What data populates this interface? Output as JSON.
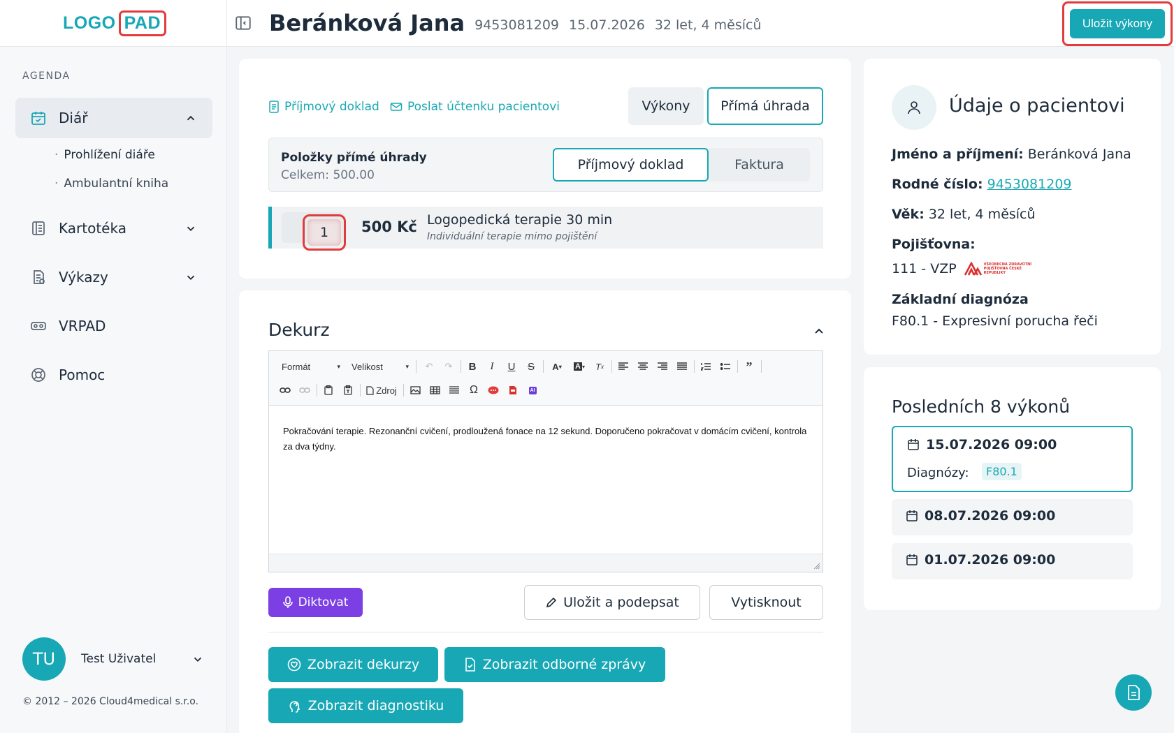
{
  "logo": {
    "part1": "LOGO",
    "part2": "PAD"
  },
  "sidebar": {
    "section_label": "AGENDA",
    "items": [
      {
        "label": "Diář",
        "icon": "calendar-icon"
      },
      {
        "label": "Kartotéka",
        "icon": "file-cabinet-icon"
      },
      {
        "label": "Výkazy",
        "icon": "report-icon"
      },
      {
        "label": "VRPAD",
        "icon": "vr-headset-icon"
      },
      {
        "label": "Pomoc",
        "icon": "lifebuoy-icon"
      }
    ],
    "sub_items": [
      "Prohlížení diáře",
      "Ambulantní kniha"
    ],
    "user": {
      "initials": "TU",
      "name": "Test Uživatel"
    },
    "copyright": "© 2012 – 2026 Cloud4medical s.r.o."
  },
  "header": {
    "patient_name": "Beránková Jana",
    "birth_number": "9453081209",
    "date": "15.07.2026",
    "age": "32 let, 4 měsíců",
    "save_label": "Uložit výkony"
  },
  "payment": {
    "link_receipt": "Příjmový doklad",
    "link_send": "Poslat účtenku pacientovi",
    "tab_vykony": "Výkony",
    "tab_prima": "Přímá úhrada",
    "items_title": "Položky přímé úhrady",
    "items_total": "Celkem: 500.00",
    "doc_receipt": "Příjmový doklad",
    "doc_invoice": "Faktura",
    "item": {
      "quantity": "1",
      "price": "500 Kč",
      "name": "Logopedická terapie 30 min",
      "subtitle": "Individuální terapie mimo pojištění"
    }
  },
  "dekurz": {
    "title": "Dekurz",
    "toolbar": {
      "format": "Formát",
      "size": "Velikost",
      "source": "Zdroj",
      "bold": "B",
      "italic": "I",
      "underline": "U",
      "strike": "S",
      "omega": "Ω",
      "ai": "AI"
    },
    "content": "Pokračování terapie. Rezonanční cvičení, prodloužená fonace na 12 sekund. Doporučeno pokračovat v domácím cvičení, kontrola za dva týdny.",
    "btn_dictate": "Diktovat",
    "btn_save_sign": "Uložit a podepsat",
    "btn_print": "Vytisknout",
    "btn_show_dekurzy": "Zobrazit dekurzy",
    "btn_show_reports": "Zobrazit odborné zprávy",
    "btn_show_diag": "Zobrazit diagnostiku"
  },
  "patient": {
    "title": "Údaje o pacientovi",
    "name_label": "Jméno a příjmení:",
    "name_value": "Beránková Jana",
    "rc_label": "Rodné číslo:",
    "rc_value": "9453081209",
    "age_label": "Věk:",
    "age_value": "32 let, 4 měsíců",
    "insurer_label": "Pojišťovna:",
    "insurer_value": "111 - VZP",
    "insurer_logo_text": "VŠEOBECNÁ ZDRAVOTNÍ POJIŠŤOVNA ČESKÉ REPUBLIKY",
    "diag_label": "Základní diagnóza",
    "diag_value": "F80.1 - Expresivní porucha řeči"
  },
  "history": {
    "title": "Posledních 8 výkonů",
    "items": [
      {
        "date": "15.07.2026 09:00",
        "diag_label": "Diagnózy:",
        "diag": "F80.1"
      },
      {
        "date": "08.07.2026 09:00"
      },
      {
        "date": "01.07.2026 09:00"
      }
    ]
  },
  "colors": {
    "accent": "#17a7b5",
    "dictate": "#7b3fe4",
    "highlight": "#e23b3b"
  }
}
